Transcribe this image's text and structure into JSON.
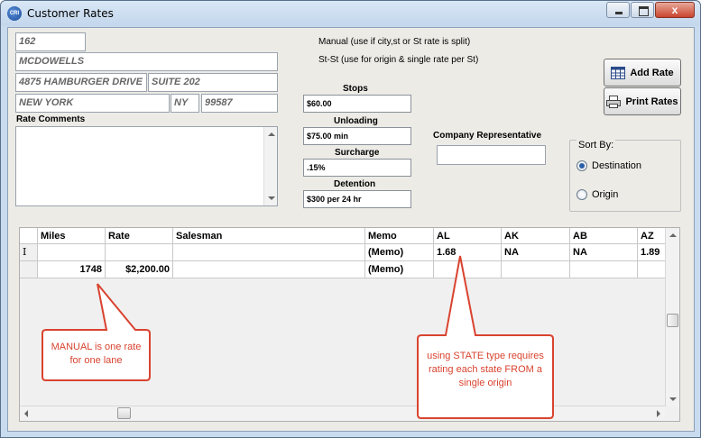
{
  "window": {
    "title": "Customer Rates",
    "app_icon": "freight-app-icon",
    "close_glyph": "x"
  },
  "customer": {
    "id": "162",
    "name": "MCDOWELLS",
    "address1": "4875 HAMBURGER DRIVE",
    "address2": "SUITE 202",
    "city": "NEW YORK",
    "state": "NY",
    "zip": "99587"
  },
  "rate_comments": {
    "label": "Rate Comments",
    "value": ""
  },
  "notes": {
    "manual": "Manual (use if city,st or St rate is split)",
    "stst": "St-St (use for origin & single rate per St)"
  },
  "charges": {
    "stops_label": "Stops",
    "stops": "$60.00",
    "unloading_label": "Unloading",
    "unloading": "$75.00 min",
    "surcharge_label": "Surcharge",
    "surcharge": ".15%",
    "detention_label": "Detention",
    "detention": "$300 per 24 hr"
  },
  "company_rep": {
    "label": "Company Representative",
    "value": ""
  },
  "buttons": {
    "add_rate": "Add Rate",
    "print_rates": "Print Rates"
  },
  "sort_by": {
    "label": "Sort By:",
    "options": [
      "Destination",
      "Origin"
    ],
    "selected": "Destination"
  },
  "grid": {
    "columns": [
      "Miles",
      "Rate",
      "Salesman",
      "Memo",
      "AL",
      "AK",
      "AB",
      "AZ"
    ],
    "rows": [
      [
        "",
        "",
        "",
        "(Memo)",
        "1.68",
        "NA",
        "NA",
        "1.89"
      ],
      [
        "1748",
        "$2,200.00",
        "",
        "(Memo)",
        "",
        "",
        "",
        ""
      ]
    ],
    "row_cursor": "I"
  },
  "callouts": {
    "manual": "MANUAL is one rate for one lane",
    "state": "using STATE type requires rating each state FROM a single origin"
  },
  "colors": {
    "callout_red": "#d9432f",
    "selected_radio": "#2a5fa8"
  }
}
